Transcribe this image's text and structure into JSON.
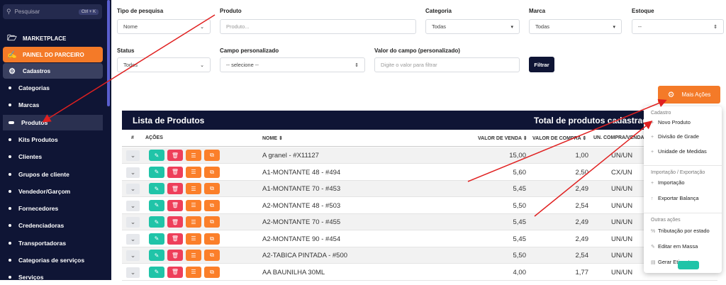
{
  "sidebar": {
    "search_placeholder": "Pesquisar",
    "search_shortcut": "Ctrl + K",
    "marketplace": "MARKETPLACE",
    "painel": "PAINEL DO PARCEIRO",
    "cadastros": "Cadastros",
    "items": [
      "Categorias",
      "Marcas",
      "Produtos",
      "Kits Produtos",
      "Clientes",
      "Grupos de cliente",
      "Vendedor/Garçom",
      "Fornecedores",
      "Credenciadoras",
      "Transportadoras",
      "Categorias de serviços",
      "Serviços"
    ]
  },
  "filters": {
    "tipo_label": "Tipo de pesquisa",
    "tipo_value": "Nome",
    "produto_label": "Produto",
    "produto_placeholder": "Produto...",
    "categoria_label": "Categoria",
    "categoria_value": "Todas",
    "marca_label": "Marca",
    "marca_value": "Todas",
    "estoque_label": "Estoque",
    "estoque_value": "--",
    "status_label": "Status",
    "status_value": "Todos",
    "campo_label": "Campo personalizado",
    "campo_value": "-- selecione --",
    "valor_label": "Valor do campo (personalizado)",
    "valor_placeholder": "Digite o valor para filtrar",
    "filter_button": "Filtrar"
  },
  "more_button": "Mais Ações",
  "table": {
    "title": "Lista de Produtos",
    "total_label": "Total de produtos cadastrados",
    "columns": {
      "hash": "#",
      "acoes": "AÇÕES",
      "nome": "NOME ⇕",
      "venda": "VALOR DE VENDA ⇕",
      "compra": "VALOR DE COMPRA ⇕",
      "un": "UN. COMPRA/VENDA"
    },
    "rows": [
      {
        "nome": "A granel - #X11127",
        "venda": "15,00",
        "compra": "1,00",
        "un": "UN/UN"
      },
      {
        "nome": "A1-MONTANTE 48 - #494",
        "venda": "5,60",
        "compra": "2,50",
        "un": "CX/UN"
      },
      {
        "nome": "A1-MONTANTE 70 - #453",
        "venda": "5,45",
        "compra": "2,49",
        "un": "UN/UN"
      },
      {
        "nome": "A2-MONTANTE 48 - #503",
        "venda": "5,50",
        "compra": "2,54",
        "un": "UN/UN"
      },
      {
        "nome": "A2-MONTANTE 70 - #455",
        "venda": "5,45",
        "compra": "2,49",
        "un": "UN/UN"
      },
      {
        "nome": "A2-MONTANTE 90 - #454",
        "venda": "5,45",
        "compra": "2,49",
        "un": "UN/UN"
      },
      {
        "nome": "A2-TABICA PINTADA - #500",
        "venda": "5,50",
        "compra": "2,54",
        "un": "UN/UN"
      },
      {
        "nome": "AA BAUNILHA 30ML",
        "venda": "4,00",
        "compra": "1,77",
        "un": "UN/UN"
      }
    ]
  },
  "dropdown": {
    "sec1": "Cadastro",
    "novo": "Novo Produto",
    "divisao": "Divisão de Grade",
    "unidade": "Unidade de Medidas",
    "sec2": "Importação / Exportação",
    "importacao": "Importação",
    "exportar": "Exportar Balança",
    "sec3": "Outras ações",
    "tributacao": "Tributação por estado",
    "editar": "Editar em Massa",
    "etiquetas": "Gerar Etiquetas"
  },
  "colors": {
    "sidebar": "#0f1535",
    "accent": "#f47a28",
    "green": "#20c4a8",
    "red": "#ee3f5a",
    "arrow": "#e02020"
  }
}
